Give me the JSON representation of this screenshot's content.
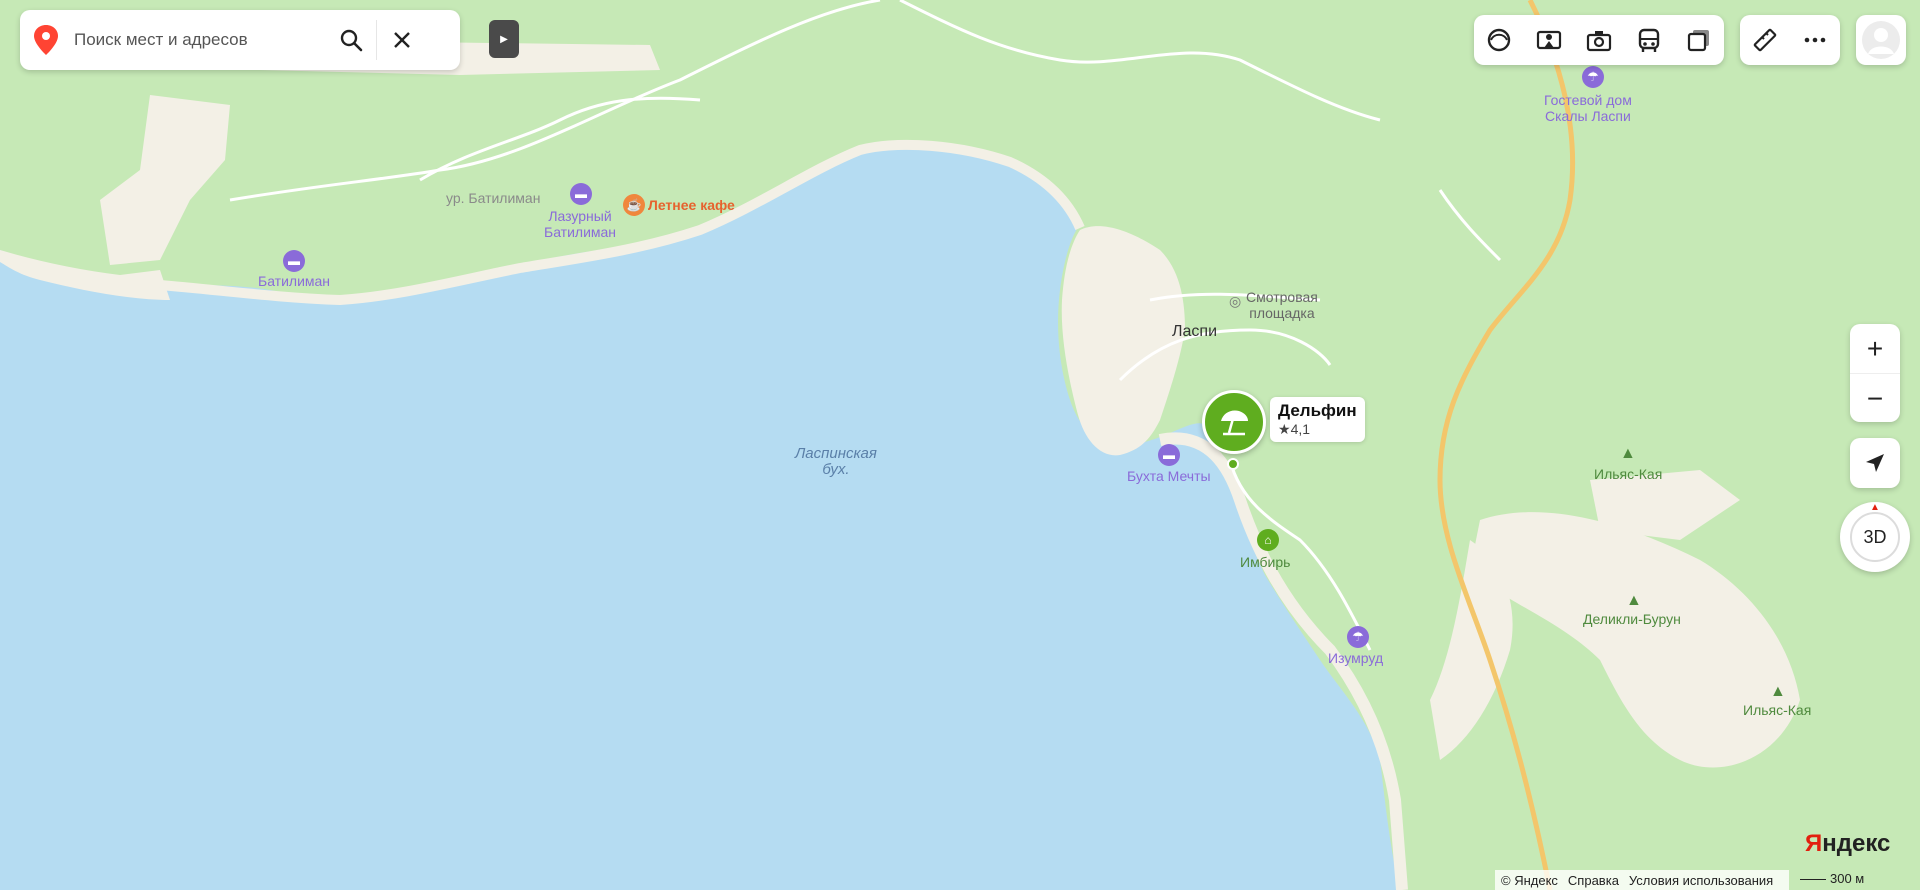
{
  "search": {
    "placeholder": "Поиск мест и адресов"
  },
  "toolbar": {
    "layers": [
      "layer-circle-icon",
      "panorama-icon",
      "photo-icon",
      "transport-icon",
      "layers-icon"
    ],
    "tools": [
      "ruler-icon",
      "more-icon"
    ]
  },
  "place": {
    "name": "Дельфин",
    "rating": "4,1"
  },
  "map_labels": {
    "gostevoy_dom": "Гостевой дом\nСкалы Ласпи",
    "ur_batiliman": "ур. Батилиман",
    "letnee_kafe": "Летнее кафе",
    "lazurny": "Лазурный\nБатилиман",
    "batiliman": "Батилиман",
    "smotrovaya": "Смотровая\nплощадка",
    "laspi": "Ласпи",
    "laspinskaya": "Ласпинская\nбух.",
    "bukhta": "Бухта Мечты",
    "imbir": "Имбирь",
    "izumrud": "Изумруд",
    "ilyas_kaya_1": "Ильяс-Кая",
    "delikli": "Деликли-Бурун",
    "ilyas_kaya_2": "Ильяс-Кая"
  },
  "controls": {
    "zoom_in": "+",
    "zoom_out": "−",
    "view3d": "3D"
  },
  "footer": {
    "copyright": "© Яндекс",
    "help": "Справка",
    "terms": "Условия использования"
  },
  "logo": {
    "y": "Я",
    "rest": "ндекс"
  },
  "scale": "300 м",
  "colors": {
    "water": "#b5dcf2",
    "forest": "#c6e9b6",
    "beach": "#f3f0e6",
    "road": "#f3c66b",
    "poi": "#8a6bd9",
    "beach_pin": "#5fad1f"
  }
}
